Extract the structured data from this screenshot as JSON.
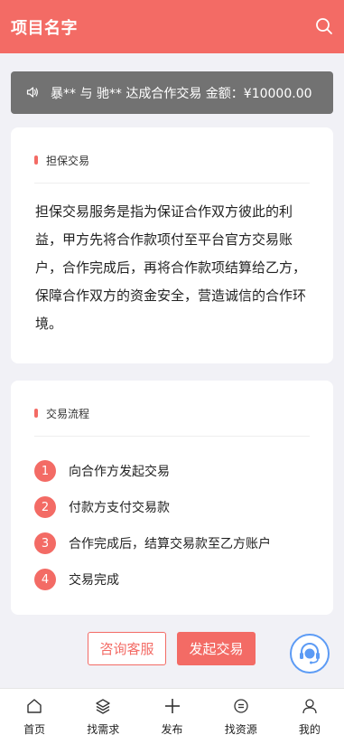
{
  "header": {
    "title": "项目名字"
  },
  "notice": {
    "text": "暴** 与 驰** 达成合作交易 金额：¥10000.00"
  },
  "guarantee": {
    "title": "担保交易",
    "body": "担保交易服务是指为保证合作双方彼此的利益，甲方先将合作款项付至平台官方交易账户，合作完成后，再将合作款项结算给乙方，保障合作双方的资金安全，营造诚信的合作环境。"
  },
  "process": {
    "title": "交易流程",
    "steps": [
      {
        "num": "1",
        "label": "向合作方发起交易"
      },
      {
        "num": "2",
        "label": "付款方支付交易款"
      },
      {
        "num": "3",
        "label": "合作完成后，结算交易款至乙方账户"
      },
      {
        "num": "4",
        "label": "交易完成"
      }
    ]
  },
  "actions": {
    "consult": "咨询客服",
    "start": "发起交易"
  },
  "tabbar": {
    "items": [
      {
        "label": "首页",
        "icon": "home-icon"
      },
      {
        "label": "找需求",
        "icon": "layers-icon"
      },
      {
        "label": "发布",
        "icon": "plus-icon"
      },
      {
        "label": "找资源",
        "icon": "resource-icon"
      },
      {
        "label": "我的",
        "icon": "user-icon"
      }
    ]
  },
  "colors": {
    "accent": "#f36b65",
    "notice_bg": "#727272",
    "cs_blue": "#5c9bf5"
  }
}
